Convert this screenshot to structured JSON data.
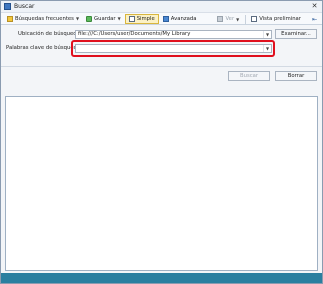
{
  "window": {
    "title": "Buscar",
    "close_glyph": "✕"
  },
  "toolbar": {
    "frequent_label": "Búsquedas frecuentes",
    "save_label": "Guardar",
    "simple_label": "Simple",
    "advanced_label": "Avanzada",
    "ver_label": "Ver",
    "preview_label": "Vista preliminar",
    "pin_glyph": "⇤"
  },
  "form": {
    "location_label": "Ubicación de búsqueda",
    "location_value": "file:///C:/Users/user/Documents/My Library",
    "browse_label": "Examinar...",
    "keywords_label": "Palabras clave de búsqueda",
    "keywords_value": "",
    "search_label": "Buscar",
    "clear_label": "Borrar",
    "dropdown_glyph": "▼"
  },
  "colors": {
    "highlight": "#e0101e",
    "statusbar": "#2a7fa0",
    "active_tab_bg": "#fbf1c5"
  },
  "icons": {
    "window": "app-window-icon",
    "frequent": "star-folder-icon",
    "save": "save-icon",
    "simple": "simple-search-icon",
    "advanced": "advanced-search-icon",
    "ver": "view-icon",
    "preview": "preview-icon",
    "pin": "pin-icon"
  }
}
